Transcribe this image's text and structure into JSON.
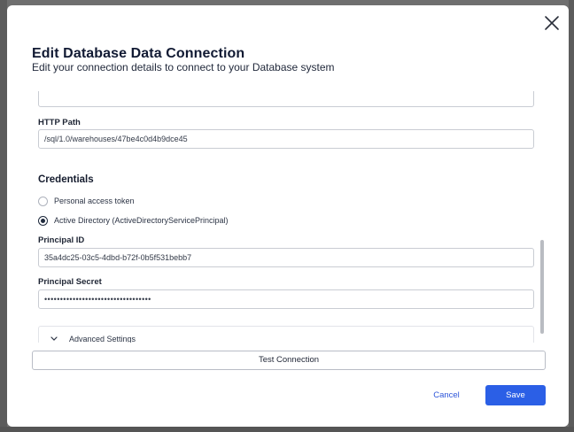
{
  "dialog": {
    "title": "Edit Database Data Connection",
    "subtitle": "Edit your connection details to connect to your Database system"
  },
  "fields": {
    "http_path_label": "HTTP Path",
    "http_path_value": "/sql/1.0/warehouses/47be4c0d4b9dce45",
    "principal_id_label": "Principal ID",
    "principal_id_value": "35a4dc25-03c5-4dbd-b72f-0b5f531bebb7",
    "principal_secret_label": "Principal Secret",
    "principal_secret_value": "••••••••••••••••••••••••••••••••••"
  },
  "credentials": {
    "heading": "Credentials",
    "options": [
      {
        "label": "Personal access token",
        "selected": false
      },
      {
        "label": "Active Directory (ActiveDirectoryServicePrincipal)",
        "selected": true
      }
    ]
  },
  "advanced": {
    "label": "Advanced Settings"
  },
  "buttons": {
    "test_connection": "Test Connection",
    "cancel": "Cancel",
    "save": "Save"
  },
  "colors": {
    "primary": "#2b5fe6",
    "link": "#2d55d9",
    "heading": "#111a33"
  },
  "icons": {
    "close": "close-icon",
    "chevron": "chevron-down-icon"
  }
}
